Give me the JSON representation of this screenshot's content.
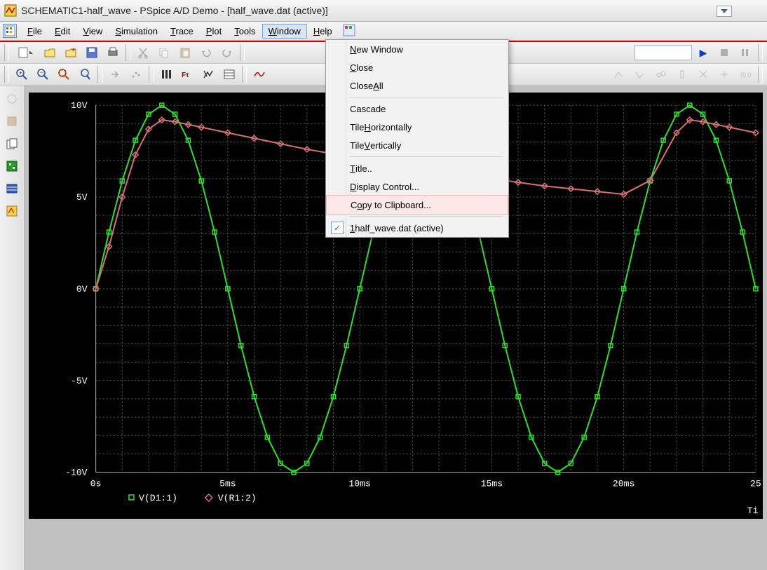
{
  "title": "SCHEMATIC1-half_wave - PSpice A/D Demo  - [half_wave.dat (active)]",
  "menubar": {
    "items": [
      "File",
      "Edit",
      "View",
      "Simulation",
      "Trace",
      "Plot",
      "Tools",
      "Window",
      "Help"
    ],
    "active_index": 7
  },
  "popup": {
    "items": [
      {
        "label": "New Window",
        "u": 0
      },
      {
        "label": "Close",
        "u": 0
      },
      {
        "label": "Close All",
        "u": 6
      },
      {
        "sep": true
      },
      {
        "label": "Cascade",
        "u": -1
      },
      {
        "label": "Tile Horizontally",
        "u": 5
      },
      {
        "label": "Tile Vertically",
        "u": 5
      },
      {
        "sep": true
      },
      {
        "label": "Title..",
        "u": 0
      },
      {
        "label": "Display Control...",
        "u": 0
      },
      {
        "label": "Copy to Clipboard...",
        "u": 1,
        "highlight": true
      },
      {
        "sep": true
      },
      {
        "label": "1 half_wave.dat (active)",
        "u": 0,
        "checked": true
      }
    ]
  },
  "chart_data": {
    "type": "line",
    "xlabel": "",
    "ylabel": "",
    "x_ticks": [
      "0s",
      "5ms",
      "10ms",
      "15ms",
      "20ms",
      "25"
    ],
    "y_ticks": [
      "10V",
      "5V",
      "0V",
      "-5V",
      "-10V"
    ],
    "xlim": [
      0,
      25
    ],
    "ylim": [
      -10,
      10
    ],
    "corner_label": "Ti",
    "legend": [
      {
        "marker": "square",
        "color": "#2ade2a",
        "text": "V(D1:1)"
      },
      {
        "marker": "diamond",
        "color": "#d67272",
        "text": "V(R1:2)"
      }
    ],
    "series": [
      {
        "name": "V(D1:1)",
        "color": "#2ade2a",
        "marker": "square",
        "x": [
          0,
          0.5,
          1,
          1.5,
          2,
          2.5,
          3,
          3.5,
          4,
          4.5,
          5,
          5.5,
          6,
          6.5,
          7,
          7.5,
          8,
          8.5,
          9,
          9.5,
          10,
          10.5,
          11,
          11.5,
          12,
          12.5,
          13,
          13.5,
          14,
          14.5,
          15,
          15.5,
          16,
          16.5,
          17,
          17.5,
          18,
          18.5,
          19,
          19.5,
          20,
          20.5,
          21,
          21.5,
          22,
          22.5,
          23,
          23.5,
          24,
          24.5,
          25
        ],
        "y": [
          0.0,
          3.09,
          5.88,
          8.09,
          9.51,
          10.0,
          9.51,
          8.09,
          5.88,
          3.09,
          0.0,
          -3.09,
          -5.88,
          -8.09,
          -9.51,
          -10.0,
          -9.51,
          -8.09,
          -5.88,
          -3.09,
          0.0,
          3.09,
          5.88,
          8.09,
          9.51,
          10.0,
          9.51,
          8.09,
          5.88,
          3.09,
          0.0,
          -3.09,
          -5.88,
          -8.09,
          -9.51,
          -10.0,
          -9.51,
          -8.09,
          -5.88,
          -3.09,
          0.0,
          3.09,
          5.88,
          8.09,
          9.51,
          10.0,
          9.51,
          8.09,
          5.88,
          3.09,
          0.0
        ]
      },
      {
        "name": "V(R1:2)",
        "color": "#d67272",
        "marker": "diamond",
        "x": [
          0,
          0.5,
          1,
          1.5,
          2,
          2.5,
          3,
          3.5,
          4,
          5,
          6,
          7,
          8,
          9,
          10,
          11,
          12,
          13,
          14,
          15,
          16,
          17,
          18,
          19,
          20,
          21,
          22,
          22.5,
          23,
          23.5,
          24,
          25
        ],
        "y": [
          0.0,
          2.3,
          5.0,
          7.3,
          8.7,
          9.2,
          9.1,
          8.95,
          8.8,
          8.5,
          8.2,
          7.9,
          7.6,
          7.35,
          7.1,
          6.85,
          6.6,
          6.4,
          6.2,
          6.0,
          5.8,
          5.6,
          5.45,
          5.3,
          5.15,
          5.9,
          8.5,
          9.2,
          9.1,
          8.95,
          8.8,
          8.5
        ]
      }
    ]
  },
  "toolbar_icons": {
    "new": "new-icon",
    "open": "open-icon",
    "openplus": "open-plus-icon",
    "save": "save-icon",
    "print": "print-icon",
    "cut": "cut-icon",
    "copy": "copy-icon",
    "paste": "paste-icon",
    "undo": "undo-icon",
    "redo": "redo-icon",
    "zoomin": "zoom-in-icon",
    "zoomout": "zoom-out-icon",
    "zoomarea": "zoom-area-icon",
    "zoomfit": "zoom-fit-icon",
    "logx": "log-x-icon",
    "fft": "fft-icon",
    "perf": "perf-icon",
    "list": "list-icon",
    "wave": "wave-icon",
    "play": "play-icon",
    "pause": "pause-icon",
    "stop": "stop-icon"
  }
}
